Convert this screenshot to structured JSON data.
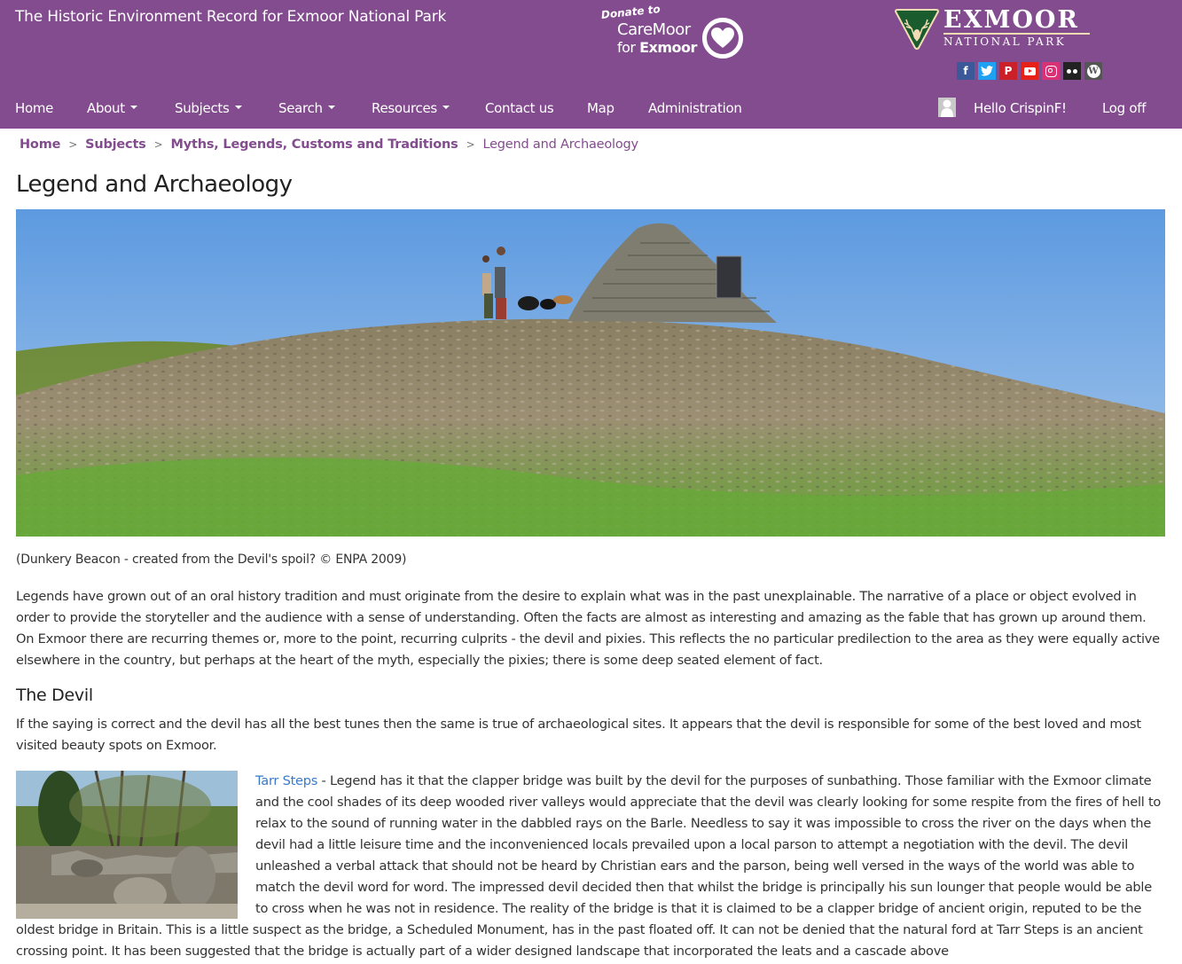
{
  "header": {
    "site_title": "The Historic Environment Record for Exmoor National Park",
    "donate": {
      "line1": "Donate to",
      "line2": "CareMoor",
      "line3_prefix": "for ",
      "line3_bold": "Exmoor",
      "icon": "heart-icon"
    },
    "logo": {
      "name": "EXMOOR",
      "subtitle": "NATIONAL PARK",
      "icon": "stag-shield-icon",
      "accent_color": "#1a5c2e"
    },
    "social": [
      {
        "name": "facebook",
        "glyph": "f",
        "color": "#3b5998"
      },
      {
        "name": "twitter",
        "glyph": "t",
        "color": "#1da1f2"
      },
      {
        "name": "pinterest",
        "glyph": "P",
        "color": "#cb2027"
      },
      {
        "name": "youtube",
        "glyph": "▶",
        "color": "#e62117"
      },
      {
        "name": "instagram",
        "glyph": "◎",
        "color": "#d93175"
      },
      {
        "name": "flickr",
        "glyph": "••",
        "color": "#222222"
      },
      {
        "name": "wordpress",
        "glyph": "W",
        "color": "#555555"
      }
    ],
    "brand_color": "#834c8f"
  },
  "nav": {
    "items": [
      {
        "label": "Home",
        "dropdown": false
      },
      {
        "label": "About",
        "dropdown": true
      },
      {
        "label": "Subjects",
        "dropdown": true
      },
      {
        "label": "Search",
        "dropdown": true
      },
      {
        "label": "Resources",
        "dropdown": true
      },
      {
        "label": "Contact us",
        "dropdown": false
      },
      {
        "label": "Map",
        "dropdown": false
      },
      {
        "label": "Administration",
        "dropdown": false
      }
    ],
    "greeting": "Hello CrispinF!",
    "logoff": "Log off",
    "avatar_icon": "user-avatar-icon"
  },
  "breadcrumb": {
    "items": [
      "Home",
      "Subjects",
      "Myths, Legends, Customs and Traditions"
    ],
    "separator": ">",
    "current": "Legend and Archaeology"
  },
  "page": {
    "title": "Legend and Archaeology",
    "hero_caption": "(Dunkery Beacon - created from the Devil's spoil? © ENPA 2009)",
    "intro": "Legends have grown out of an oral history tradition and must originate from the desire to explain what was in the past unexplainable. The narrative of a place or object evolved in order to provide the storyteller and the audience with a sense of understanding. Often the facts are almost as interesting and amazing as the fable that has grown up around them. On Exmoor there are recurring themes or, more to the point, recurring culprits - the devil and pixies. This reflects the no particular predilection to the area as they were equally active elsewhere in the country, but perhaps at the heart of the myth, especially the pixies; there is some deep seated element of fact.",
    "section_heading": "The Devil",
    "section_intro": "If the saying is correct and the devil has all the best tunes then the same is true of archaeological sites. It appears that the devil is responsible for some of the best loved and most visited beauty spots on Exmoor.",
    "tarr_link": "Tarr Steps",
    "tarr_text": " - Legend has it that the clapper bridge was built by the devil for the purposes of sunbathing. Those familiar with the Exmoor climate and the cool shades of its deep wooded river valleys would appreciate that the devil was clearly looking for some respite from the fires of hell to relax to the sound of running water in the dabbled rays on the Barle. Needless to say it was impossible to cross the river on the days when the devil had a little leisure time and the inconvenienced locals prevailed upon a local parson to attempt a negotiation with the devil. The devil unleashed a verbal attack that should not be heard by Christian ears and the parson, being well versed in the ways of the world was able to match the devil word for word. The impressed devil decided then that whilst the bridge is principally his sun lounger that people would be able to cross when he was not in residence. The reality of the bridge is that it is claimed to be a clapper bridge of ancient origin, reputed to be the oldest bridge in Britain. This is a little suspect as the bridge, a Scheduled Monument, has in the past floated off. It can not be denied that the natural ford at Tarr Steps is an ancient crossing point. It has been suggested that the bridge is actually part of a wider designed landscape that incorporated the leats and a cascade above",
    "link_color": "#3a7ac9"
  }
}
